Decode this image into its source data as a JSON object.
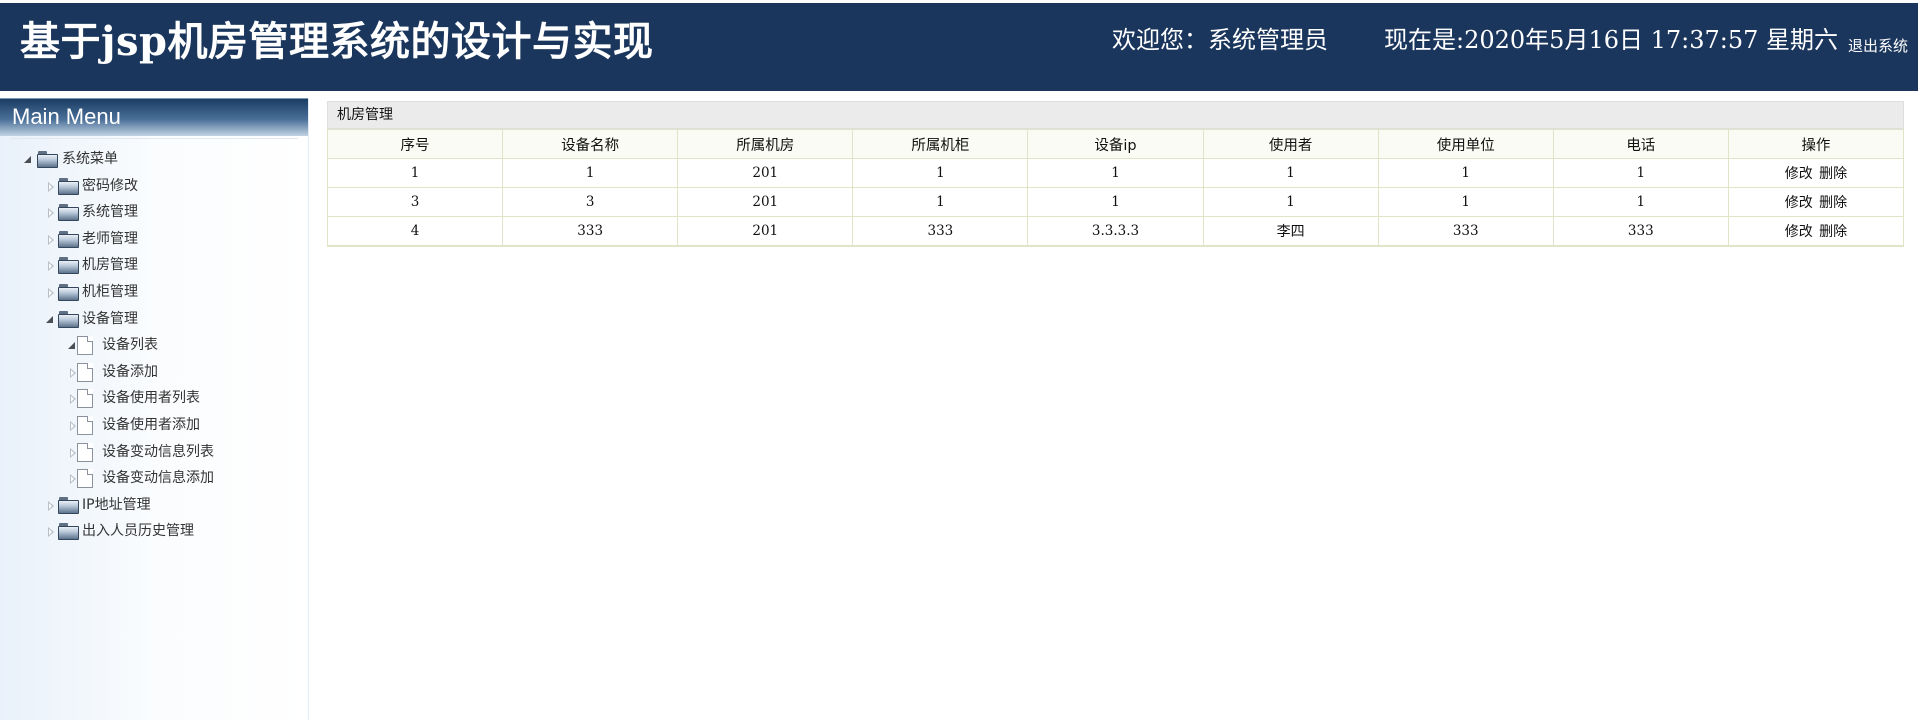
{
  "header": {
    "title": "基于jsp机房管理系统的设计与实现",
    "welcome_prefix": "欢迎您：",
    "username": "系统管理员",
    "now_prefix": "现在是:",
    "datetime": "2020年5月16日 17:37:57 星期六",
    "logout": "退出系统",
    "bg_color": "#1b365d"
  },
  "sidebar": {
    "title": "Main Menu",
    "tree": [
      {
        "label": "系统菜单",
        "level": 0,
        "type": "folder",
        "expanded": true
      },
      {
        "label": "密码修改",
        "level": 1,
        "type": "folder",
        "expanded": false
      },
      {
        "label": "系统管理",
        "level": 1,
        "type": "folder",
        "expanded": false
      },
      {
        "label": "老师管理",
        "level": 1,
        "type": "folder",
        "expanded": false
      },
      {
        "label": "机房管理",
        "level": 1,
        "type": "folder",
        "expanded": false
      },
      {
        "label": "机柜管理",
        "level": 1,
        "type": "folder",
        "expanded": false
      },
      {
        "label": "设备管理",
        "level": 1,
        "type": "folder",
        "expanded": true
      },
      {
        "label": "设备列表",
        "level": 2,
        "type": "page",
        "expanded": true
      },
      {
        "label": "设备添加",
        "level": 2,
        "type": "page",
        "expanded": false
      },
      {
        "label": "设备使用者列表",
        "level": 2,
        "type": "page",
        "expanded": false
      },
      {
        "label": "设备使用者添加",
        "level": 2,
        "type": "page",
        "expanded": false
      },
      {
        "label": "设备变动信息列表",
        "level": 2,
        "type": "page",
        "expanded": false
      },
      {
        "label": "设备变动信息添加",
        "level": 2,
        "type": "page",
        "expanded": false
      },
      {
        "label": "IP地址管理",
        "level": 1,
        "type": "folder",
        "expanded": false
      },
      {
        "label": "出入人员历史管理",
        "level": 1,
        "type": "folder",
        "expanded": false
      }
    ]
  },
  "main": {
    "panel_title": "机房管理",
    "columns": [
      "序号",
      "设备名称",
      "所属机房",
      "所属机柜",
      "设备ip",
      "使用者",
      "使用单位",
      "电话",
      "操作"
    ],
    "rows": [
      [
        "1",
        "1",
        "201",
        "1",
        "1",
        "1",
        "1",
        "1"
      ],
      [
        "3",
        "3",
        "201",
        "1",
        "1",
        "1",
        "1",
        "1"
      ],
      [
        "4",
        "333",
        "201",
        "333",
        "3.3.3.3",
        "李四",
        "333",
        "333"
      ]
    ],
    "actions": {
      "edit": "修改",
      "delete": "删除"
    }
  }
}
